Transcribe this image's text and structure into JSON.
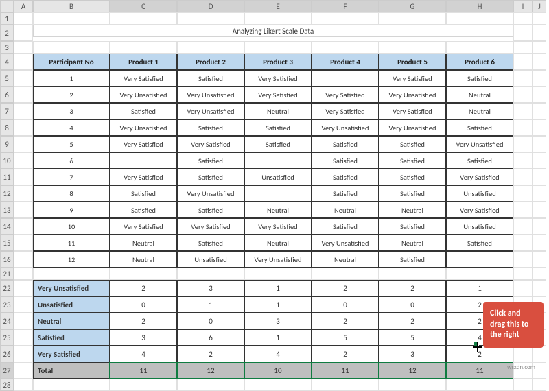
{
  "columns": [
    "A",
    "B",
    "C",
    "D",
    "E",
    "F",
    "G",
    "H",
    "I",
    "J"
  ],
  "row_headers_top": [
    "1",
    "2",
    "3"
  ],
  "row_headers_data": [
    "4",
    "5",
    "6",
    "7",
    "8",
    "9",
    "10",
    "11",
    "12",
    "13",
    "14",
    "15",
    "16"
  ],
  "row_headers_gap": "21",
  "row_headers_summary": [
    "22",
    "23",
    "24",
    "25",
    "26",
    "27",
    "28"
  ],
  "title": "Analyzing Likert Scale Data",
  "headers": {
    "participant": "Participant No",
    "products": [
      "Product 1",
      "Product 2",
      "Product 3",
      "Product 4",
      "Product 5",
      "Product 6"
    ]
  },
  "data": [
    {
      "id": "1",
      "v": [
        "Very Satisfied",
        "Satisfied",
        "Very Satisfied",
        "",
        "Very Satisfied",
        "Satisfied"
      ]
    },
    {
      "id": "2",
      "v": [
        "Very Unsatisfied",
        "Very Unsatisfied",
        "Very Satisfied",
        "Very Satisfied",
        "Very Unsatisfied",
        "Neutral"
      ]
    },
    {
      "id": "3",
      "v": [
        "Satisfied",
        "Very Unsatisfied",
        "Neutral",
        "Very Satisfied",
        "Very Satisfied",
        "Neutral"
      ]
    },
    {
      "id": "4",
      "v": [
        "Very Unsatisfied",
        "Satisfied",
        "Satisfied",
        "Very Unsatisfied",
        "Very Unsatisfied",
        "Satisfied"
      ]
    },
    {
      "id": "5",
      "v": [
        "Very Satisfied",
        "Very Satisfied",
        "Satisfied",
        "Satisfied",
        "Satisfied",
        "Very Unsatisfied"
      ]
    },
    {
      "id": "6",
      "v": [
        "",
        "Satisfied",
        "",
        "Satisfied",
        "Satisfied",
        "Satisfied"
      ]
    },
    {
      "id": "7",
      "v": [
        "Very Satisfied",
        "Satisfied",
        "Unsatisfied",
        "Satisfied",
        "Satisfied",
        "Very Satisfied"
      ]
    },
    {
      "id": "8",
      "v": [
        "Satisfied",
        "Very Unsatisfied",
        "",
        "Satisfied",
        "Satisfied",
        "Unsatisfied"
      ]
    },
    {
      "id": "9",
      "v": [
        "Satisfied",
        "Satisfied",
        "Neutral",
        "Neutral",
        "Neutral",
        "Very Satisfied"
      ]
    },
    {
      "id": "10",
      "v": [
        "Very Satisfied",
        "Very Satisfied",
        "Very Satisfied",
        "Satisfied",
        "Satisfied",
        "Unsatisfied"
      ]
    },
    {
      "id": "11",
      "v": [
        "Neutral",
        "Satisfied",
        "Neutral",
        "Very Unsatisfied",
        "Neutral",
        "Satisfied"
      ]
    },
    {
      "id": "12",
      "v": [
        "Neutral",
        "Unsatisfied",
        "Very Unsatisfied",
        "Neutral",
        "Satisfied",
        ""
      ]
    }
  ],
  "summary": {
    "rows": [
      {
        "label": "Very Unsatisfied",
        "v": [
          "2",
          "3",
          "1",
          "2",
          "2",
          "1"
        ]
      },
      {
        "label": "Unsatisfied",
        "v": [
          "0",
          "1",
          "1",
          "0",
          "0",
          "2"
        ]
      },
      {
        "label": "Neutral",
        "v": [
          "2",
          "0",
          "3",
          "2",
          "2",
          "2"
        ]
      },
      {
        "label": "Satisfied",
        "v": [
          "3",
          "6",
          "1",
          "5",
          "5",
          "4"
        ]
      },
      {
        "label": "Very Satisfied",
        "v": [
          "4",
          "2",
          "4",
          "2",
          "3",
          "2"
        ]
      },
      {
        "label": "Total",
        "v": [
          "11",
          "12",
          "10",
          "11",
          "12",
          "11"
        ]
      }
    ]
  },
  "callout": "Click and drag this to the right",
  "watermark": "wsxdn.com"
}
